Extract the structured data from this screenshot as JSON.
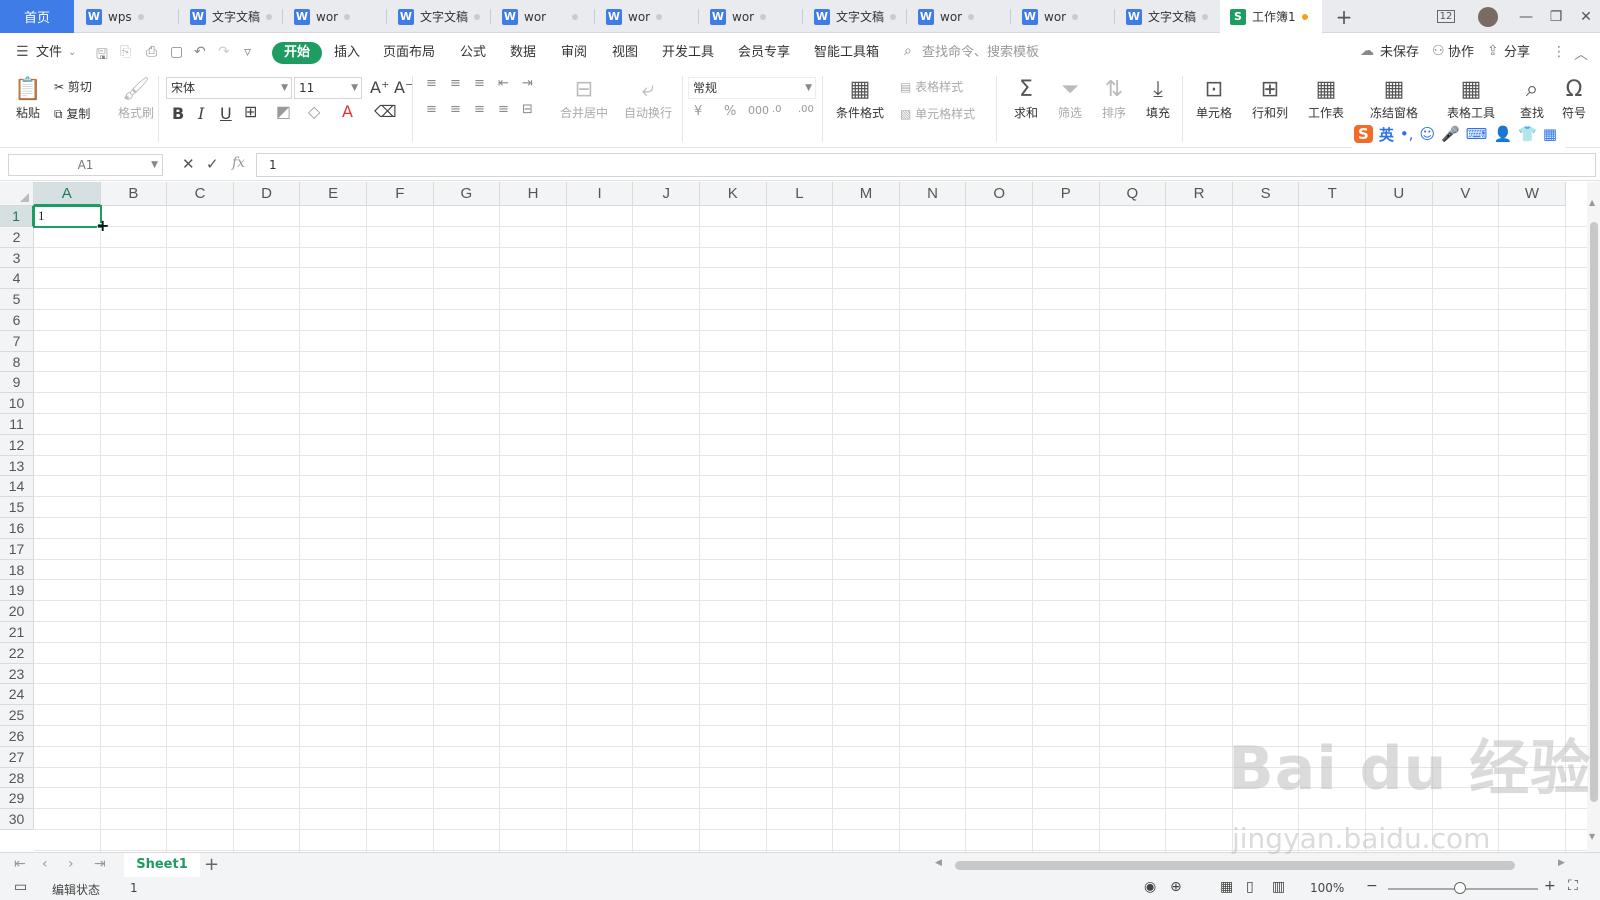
{
  "tabs": [
    {
      "label": "首页",
      "kind": "home"
    },
    {
      "label": "wps",
      "kind": "w"
    },
    {
      "label": "文字文稿",
      "kind": "w"
    },
    {
      "label": "wor",
      "kind": "w"
    },
    {
      "label": "文字文稿",
      "kind": "w"
    },
    {
      "label": "wor",
      "kind": "w"
    },
    {
      "label": "wor",
      "kind": "w"
    },
    {
      "label": "wor",
      "kind": "w"
    },
    {
      "label": "文字文稿",
      "kind": "w"
    },
    {
      "label": "wor",
      "kind": "w"
    },
    {
      "label": "wor",
      "kind": "w"
    },
    {
      "label": "文字文稿",
      "kind": "w"
    },
    {
      "label": "工作簿1",
      "kind": "s"
    }
  ],
  "window": {
    "add_tab": "+",
    "badge": "12",
    "minimize": "—",
    "restore": "❐",
    "close": "✕"
  },
  "menu": {
    "file": "文件",
    "items": [
      "开始",
      "插入",
      "页面布局",
      "公式",
      "数据",
      "审阅",
      "视图",
      "开发工具",
      "会员专享",
      "智能工具箱"
    ],
    "search_placeholder": "查找命令、搜索模板",
    "unsaved": "未保存",
    "collab": "协作",
    "share": "分享"
  },
  "ribbon": {
    "paste": "粘贴",
    "cut": "剪切",
    "copy": "复制",
    "format_painter": "格式刷",
    "font_name": "宋体",
    "font_size": "11",
    "merge_center": "合并居中",
    "wrap_text": "自动换行",
    "number_format": "常规",
    "conditional_format": "条件格式",
    "table_style": "表格样式",
    "cell_style": "单元格样式",
    "sum": "求和",
    "filter": "筛选",
    "sort": "排序",
    "fill": "填充",
    "cells": "单元格",
    "rows_cols": "行和列",
    "worksheet": "工作表",
    "freeze": "冻结窗格",
    "table_tools": "表格工具",
    "find": "查找",
    "symbol": "符号"
  },
  "sogou": {
    "label": "英"
  },
  "formula_bar": {
    "name_box": "A1",
    "content": "1",
    "fx": "fx"
  },
  "grid": {
    "columns": [
      "A",
      "B",
      "C",
      "D",
      "E",
      "F",
      "G",
      "H",
      "I",
      "J",
      "K",
      "L",
      "M",
      "N",
      "O",
      "P",
      "Q",
      "R",
      "S",
      "T",
      "U",
      "V",
      "W"
    ],
    "rows": [
      "1",
      "2",
      "3",
      "4",
      "5",
      "6",
      "7",
      "8",
      "9",
      "10",
      "11",
      "12",
      "13",
      "14",
      "15",
      "16",
      "17",
      "18",
      "19",
      "20",
      "21",
      "22",
      "23",
      "24",
      "25",
      "26",
      "27",
      "28",
      "29",
      "30"
    ],
    "active_cell_value": "1"
  },
  "sheets": {
    "active": "Sheet1",
    "add": "+"
  },
  "status": {
    "mode": "编辑状态",
    "value": "1",
    "zoom": "100%"
  },
  "watermark": {
    "main": "Bai du 经验",
    "sub": "jingyan.baidu.com"
  },
  "colors": {
    "accent": "#1e9c62",
    "home_tab": "#3f7ce8"
  }
}
